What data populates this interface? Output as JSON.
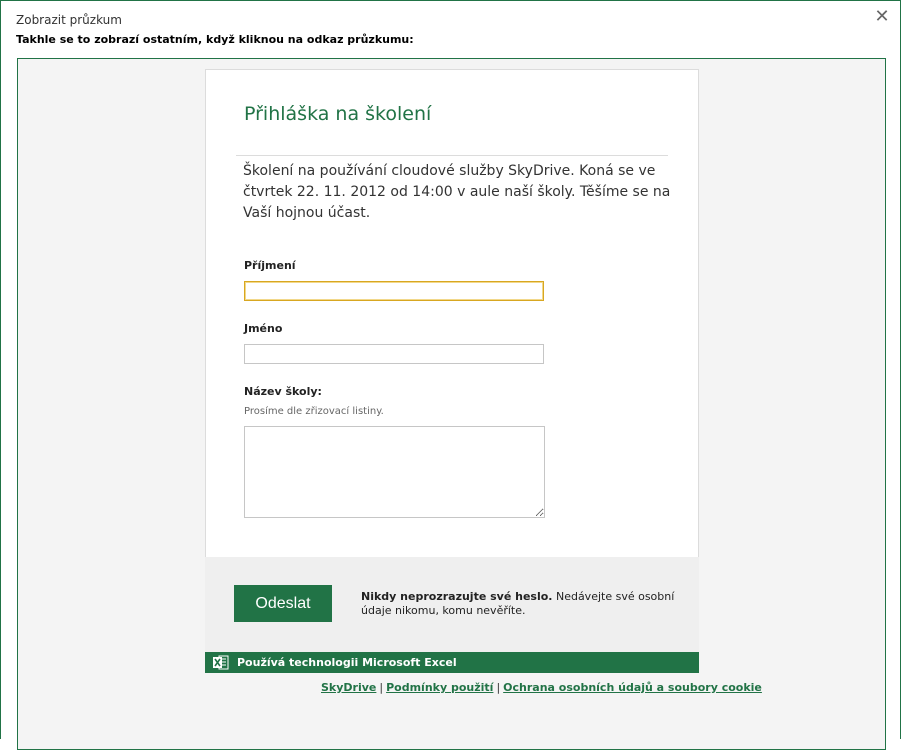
{
  "dialog": {
    "title": "Zobrazit průzkum",
    "subtitle": "Takhle se to zobrazí ostatním, když kliknou na odkaz průzkumu:",
    "close_symbol": "✕"
  },
  "survey": {
    "title": "Přihláška na školení",
    "description": "Školení na používání cloudové služby SkyDrive. Koná se ve čtvrtek 22. 11. 2012 od 14:00 v aule naší školy. Těšíme se na Vaší hojnou účast.",
    "fields": [
      {
        "label": "Příjmení",
        "value": ""
      },
      {
        "label": "Jméno",
        "value": ""
      },
      {
        "label": "Název školy:",
        "hint": "Prosíme dle zřizovací listiny.",
        "value": ""
      }
    ]
  },
  "footer": {
    "submit_label": "Odeslat",
    "warning_bold": "Nikdy neprozrazujte své heslo.",
    "warning_text": " Nedávejte své osobní údaje nikomu, komu nevěříte.",
    "powered_by": "Používá technologii Microsoft Excel"
  },
  "links": {
    "skydrive": "SkyDrive",
    "terms": "Podmínky použití",
    "privacy": "Ochrana osobních údajů a soubory cookie",
    "separator": "|"
  },
  "colors": {
    "accent": "#217346",
    "focus_border": "#d8a721"
  }
}
